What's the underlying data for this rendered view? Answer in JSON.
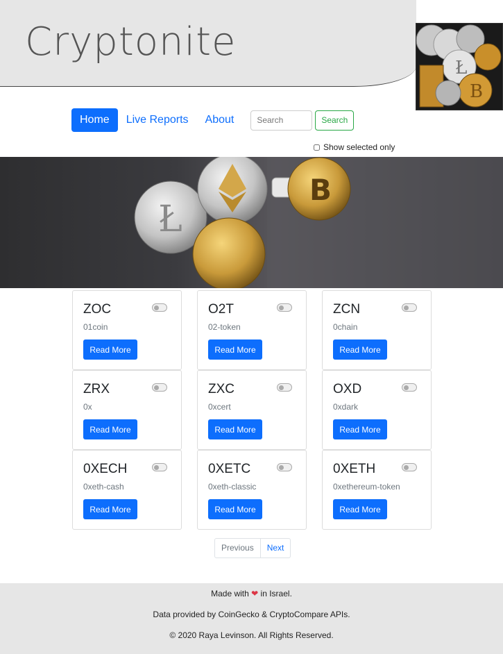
{
  "header": {
    "title": "Cryptonite"
  },
  "nav": {
    "items": [
      {
        "label": "Home",
        "active": true
      },
      {
        "label": "Live Reports",
        "active": false
      },
      {
        "label": "About",
        "active": false
      }
    ],
    "search_placeholder": "Search",
    "search_button": "Search",
    "show_selected_label": "Show selected only"
  },
  "coins": [
    {
      "symbol": "ZOC",
      "name": "01coin",
      "button": "Read More"
    },
    {
      "symbol": "O2T",
      "name": "02-token",
      "button": "Read More"
    },
    {
      "symbol": "ZCN",
      "name": "0chain",
      "button": "Read More"
    },
    {
      "symbol": "ZRX",
      "name": "0x",
      "button": "Read More"
    },
    {
      "symbol": "ZXC",
      "name": "0xcert",
      "button": "Read More"
    },
    {
      "symbol": "OXD",
      "name": "0xdark",
      "button": "Read More"
    },
    {
      "symbol": "0XECH",
      "name": "0xeth-cash",
      "button": "Read More"
    },
    {
      "symbol": "0XETC",
      "name": "0xeth-classic",
      "button": "Read More"
    },
    {
      "symbol": "0XETH",
      "name": "0xethereum-token",
      "button": "Read More"
    }
  ],
  "pagination": {
    "previous": "Previous",
    "next": "Next"
  },
  "footer": {
    "made_with_prefix": "Made with",
    "made_with_suffix": "in Israel.",
    "data_line": "Data provided by CoinGecko & CryptoCompare APIs.",
    "copyright": "© 2020 Raya Levinson. All Rights Reserved."
  },
  "colors": {
    "primary": "#0d6efd",
    "success": "#28a745",
    "heart": "#dc3545",
    "header_bg": "#e6e6e6"
  },
  "icons": {
    "heart": "heart-icon",
    "toggle": "toggle-switch-icon"
  }
}
